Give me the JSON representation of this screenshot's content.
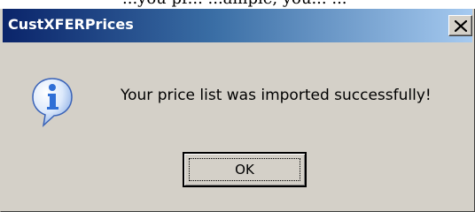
{
  "background_text": "...you pr... ...ample, you... ...",
  "dialog": {
    "title": "CustXFERPrices",
    "close_label": "×",
    "icon": "information-icon",
    "message": "Your price list was imported successfully!",
    "ok_label": "OK"
  },
  "colors": {
    "titlebar_start": "#0a246a",
    "titlebar_end": "#a6caf0",
    "dialog_face": "#d4d0c8",
    "icon_blue": "#2f6fd6"
  }
}
